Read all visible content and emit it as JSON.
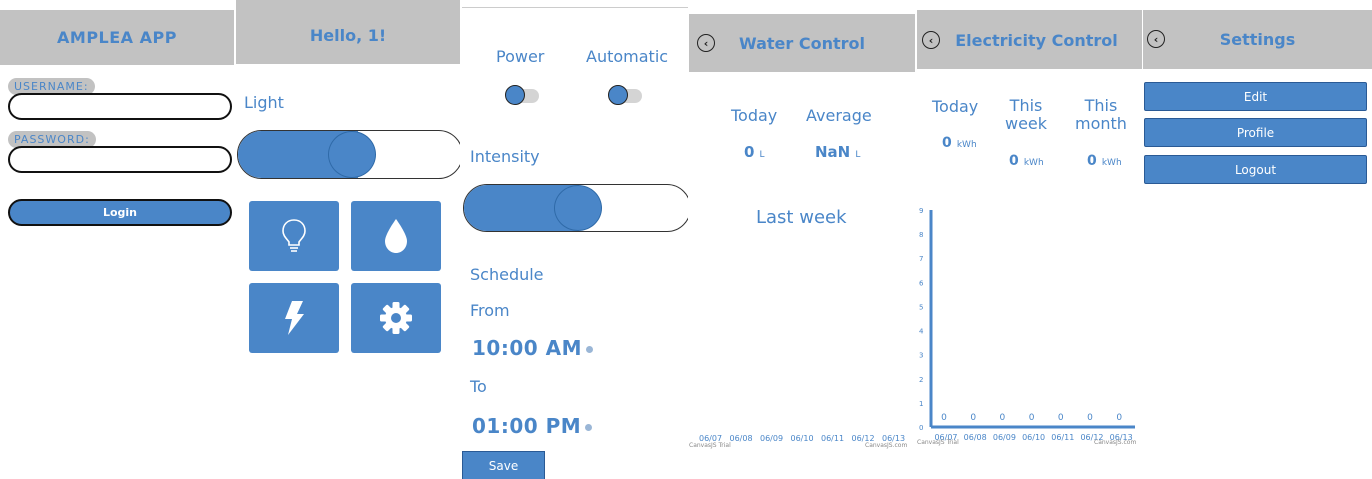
{
  "login": {
    "title": "AMPLEA APP",
    "username_label": "USERNAME:",
    "username_value": "",
    "password_label": "PASSWORD:",
    "password_value": "",
    "login_button": "Login"
  },
  "home": {
    "greeting": "Hello, 1!",
    "light_label": "Light",
    "light_toggle_on": true,
    "tiles": [
      {
        "icon": "lightbulb-icon"
      },
      {
        "icon": "water-drop-icon"
      },
      {
        "icon": "lightning-icon"
      },
      {
        "icon": "gear-icon"
      }
    ]
  },
  "light_control": {
    "power_label": "Power",
    "automatic_label": "Automatic",
    "intensity_label": "Intensity",
    "intensity_percent": 50,
    "schedule_label": "Schedule",
    "from_label": "From",
    "from_time": "10:00 AM",
    "to_label": "To",
    "to_time": "01:00 PM",
    "save_button": "Save"
  },
  "water": {
    "title": "Water Control",
    "today_label": "Today",
    "average_label": "Average",
    "today_value": "0",
    "today_unit": "L",
    "average_value": "NaN",
    "average_unit": "L",
    "last_week_label": "Last week",
    "x_ticks": [
      "06/07",
      "06/08",
      "06/09",
      "06/10",
      "06/11",
      "06/12",
      "06/13"
    ],
    "credit_left": "CanvasJS Trial",
    "credit_right": "CanvasJS.com"
  },
  "electricity": {
    "title": "Electricity Control",
    "today_label": "Today",
    "week_label_line1": "This",
    "week_label_line2": "week",
    "month_label_line1": "This",
    "month_label_line2": "month",
    "today_value": "0",
    "week_value": "0",
    "month_value": "0",
    "unit": "kWh",
    "credit_left": "CanvasJS Trial",
    "credit_right": "CanvasJS.com"
  },
  "settings": {
    "title": "Settings",
    "edit_button": "Edit",
    "profile_button": "Profile",
    "logout_button": "Logout"
  },
  "colors": {
    "accent": "#4a86c8",
    "header": "#c2c2c2"
  },
  "chart_data": {
    "type": "bar",
    "categories": [
      "06/07",
      "06/08",
      "06/09",
      "06/10",
      "06/11",
      "06/12",
      "06/13"
    ],
    "values": [
      0,
      0,
      0,
      0,
      0,
      0,
      0
    ],
    "title": "",
    "xlabel": "",
    "ylabel": "",
    "ylim": [
      0,
      9
    ],
    "y_ticks": [
      "0",
      "1",
      "2",
      "3",
      "4",
      "5",
      "6",
      "7",
      "8",
      "9"
    ],
    "grid": false
  }
}
